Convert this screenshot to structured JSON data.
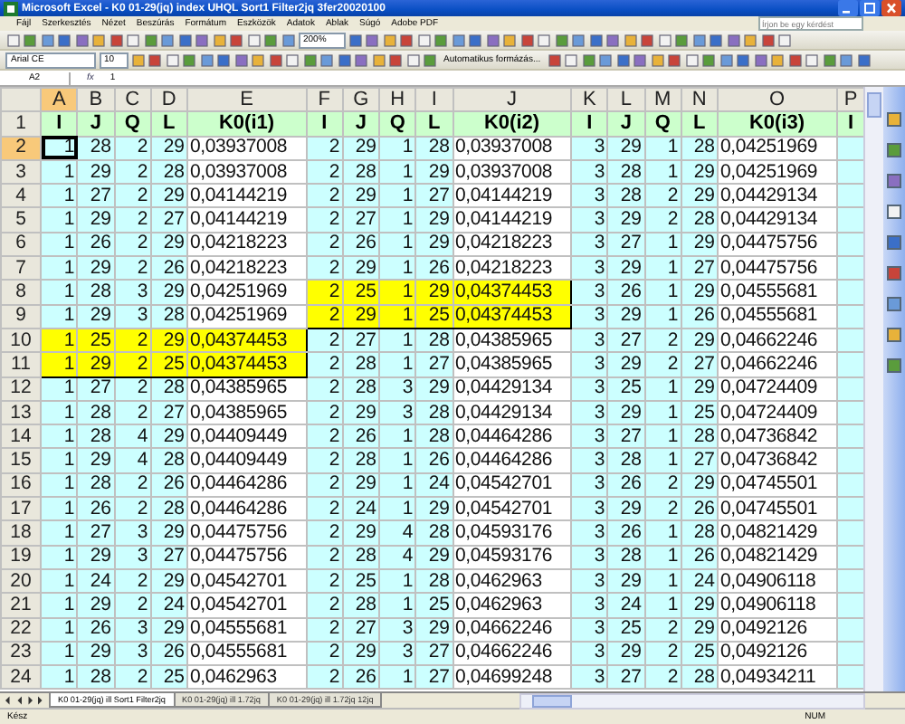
{
  "window": {
    "title": "Microsoft Excel - K0 01-29(jq) index UHQL Sort1 Filter2jq 3fer20020100"
  },
  "menu": [
    "Fájl",
    "Szerkesztés",
    "Nézet",
    "Beszúrás",
    "Formátum",
    "Eszközök",
    "Adatok",
    "Ablak",
    "Súgó",
    "Adobe PDF"
  ],
  "help_box": {
    "placeholder": "Írjon be egy kérdést"
  },
  "zoom": "200%",
  "formatting": {
    "font": "Arial CE",
    "size": "10",
    "autoformat": "Automatikus formázás..."
  },
  "formula_bar": {
    "cell": "A2",
    "function_label": "fx",
    "value": "1"
  },
  "columns": [
    {
      "letter": "A",
      "selected": true
    },
    {
      "letter": "B",
      "selected": false
    },
    {
      "letter": "C",
      "selected": false
    },
    {
      "letter": "D",
      "selected": false
    },
    {
      "letter": "E",
      "selected": false
    },
    {
      "letter": "F",
      "selected": false
    },
    {
      "letter": "G",
      "selected": false
    },
    {
      "letter": "H",
      "selected": false
    },
    {
      "letter": "I",
      "selected": false
    },
    {
      "letter": "J",
      "selected": false
    },
    {
      "letter": "K",
      "selected": false
    },
    {
      "letter": "L",
      "selected": false
    },
    {
      "letter": "M",
      "selected": false
    },
    {
      "letter": "N",
      "selected": false
    },
    {
      "letter": "O",
      "selected": false
    },
    {
      "letter": "P",
      "selected": false
    }
  ],
  "header_row": {
    "number": "1",
    "labels": [
      "I",
      "J",
      "Q",
      "L",
      "K0(i1)",
      "I",
      "J",
      "Q",
      "L",
      "K0(i2)",
      "I",
      "J",
      "Q",
      "L",
      "K0(i3)",
      "I"
    ]
  },
  "rows": [
    {
      "number": "2",
      "selected": true,
      "groups": [
        {
          "values": [
            "1",
            "28",
            "2",
            "29",
            "0,03937008"
          ],
          "highlighted": false
        },
        {
          "values": [
            "2",
            "29",
            "1",
            "28",
            "0,03937008"
          ],
          "highlighted": false
        },
        {
          "values": [
            "3",
            "29",
            "1",
            "28",
            "0,04251969"
          ],
          "highlighted": false
        }
      ]
    },
    {
      "number": "3",
      "selected": false,
      "groups": [
        {
          "values": [
            "1",
            "29",
            "2",
            "28",
            "0,03937008"
          ],
          "highlighted": false
        },
        {
          "values": [
            "2",
            "28",
            "1",
            "29",
            "0,03937008"
          ],
          "highlighted": false
        },
        {
          "values": [
            "3",
            "28",
            "1",
            "29",
            "0,04251969"
          ],
          "highlighted": false
        }
      ]
    },
    {
      "number": "4",
      "selected": false,
      "groups": [
        {
          "values": [
            "1",
            "27",
            "2",
            "29",
            "0,04144219"
          ],
          "highlighted": false
        },
        {
          "values": [
            "2",
            "29",
            "1",
            "27",
            "0,04144219"
          ],
          "highlighted": false
        },
        {
          "values": [
            "3",
            "28",
            "2",
            "29",
            "0,04429134"
          ],
          "highlighted": false
        }
      ]
    },
    {
      "number": "5",
      "selected": false,
      "groups": [
        {
          "values": [
            "1",
            "29",
            "2",
            "27",
            "0,04144219"
          ],
          "highlighted": false
        },
        {
          "values": [
            "2",
            "27",
            "1",
            "29",
            "0,04144219"
          ],
          "highlighted": false
        },
        {
          "values": [
            "3",
            "29",
            "2",
            "28",
            "0,04429134"
          ],
          "highlighted": false
        }
      ]
    },
    {
      "number": "6",
      "selected": false,
      "groups": [
        {
          "values": [
            "1",
            "26",
            "2",
            "29",
            "0,04218223"
          ],
          "highlighted": false
        },
        {
          "values": [
            "2",
            "26",
            "1",
            "29",
            "0,04218223"
          ],
          "highlighted": false
        },
        {
          "values": [
            "3",
            "27",
            "1",
            "29",
            "0,04475756"
          ],
          "highlighted": false
        }
      ]
    },
    {
      "number": "7",
      "selected": false,
      "groups": [
        {
          "values": [
            "1",
            "29",
            "2",
            "26",
            "0,04218223"
          ],
          "highlighted": false
        },
        {
          "values": [
            "2",
            "29",
            "1",
            "26",
            "0,04218223"
          ],
          "highlighted": false
        },
        {
          "values": [
            "3",
            "29",
            "1",
            "27",
            "0,04475756"
          ],
          "highlighted": false
        }
      ]
    },
    {
      "number": "8",
      "selected": false,
      "groups": [
        {
          "values": [
            "1",
            "28",
            "3",
            "29",
            "0,04251969"
          ],
          "highlighted": false
        },
        {
          "values": [
            "2",
            "25",
            "1",
            "29",
            "0,04374453"
          ],
          "highlighted": true
        },
        {
          "values": [
            "3",
            "26",
            "1",
            "29",
            "0,04555681"
          ],
          "highlighted": false
        }
      ]
    },
    {
      "number": "9",
      "selected": false,
      "groups": [
        {
          "values": [
            "1",
            "29",
            "3",
            "28",
            "0,04251969"
          ],
          "highlighted": false
        },
        {
          "values": [
            "2",
            "29",
            "1",
            "25",
            "0,04374453"
          ],
          "highlighted": true
        },
        {
          "values": [
            "3",
            "29",
            "1",
            "26",
            "0,04555681"
          ],
          "highlighted": false
        }
      ]
    },
    {
      "number": "10",
      "selected": false,
      "groups": [
        {
          "values": [
            "1",
            "25",
            "2",
            "29",
            "0,04374453"
          ],
          "highlighted": true
        },
        {
          "values": [
            "2",
            "27",
            "1",
            "28",
            "0,04385965"
          ],
          "highlighted": false
        },
        {
          "values": [
            "3",
            "27",
            "2",
            "29",
            "0,04662246"
          ],
          "highlighted": false
        }
      ]
    },
    {
      "number": "11",
      "selected": false,
      "groups": [
        {
          "values": [
            "1",
            "29",
            "2",
            "25",
            "0,04374453"
          ],
          "highlighted": true
        },
        {
          "values": [
            "2",
            "28",
            "1",
            "27",
            "0,04385965"
          ],
          "highlighted": false
        },
        {
          "values": [
            "3",
            "29",
            "2",
            "27",
            "0,04662246"
          ],
          "highlighted": false
        }
      ]
    },
    {
      "number": "12",
      "selected": false,
      "groups": [
        {
          "values": [
            "1",
            "27",
            "2",
            "28",
            "0,04385965"
          ],
          "highlighted": false
        },
        {
          "values": [
            "2",
            "28",
            "3",
            "29",
            "0,04429134"
          ],
          "highlighted": false
        },
        {
          "values": [
            "3",
            "25",
            "1",
            "29",
            "0,04724409"
          ],
          "highlighted": false
        }
      ]
    },
    {
      "number": "13",
      "selected": false,
      "groups": [
        {
          "values": [
            "1",
            "28",
            "2",
            "27",
            "0,04385965"
          ],
          "highlighted": false
        },
        {
          "values": [
            "2",
            "29",
            "3",
            "28",
            "0,04429134"
          ],
          "highlighted": false
        },
        {
          "values": [
            "3",
            "29",
            "1",
            "25",
            "0,04724409"
          ],
          "highlighted": false
        }
      ]
    },
    {
      "number": "14",
      "selected": false,
      "groups": [
        {
          "values": [
            "1",
            "28",
            "4",
            "29",
            "0,04409449"
          ],
          "highlighted": false
        },
        {
          "values": [
            "2",
            "26",
            "1",
            "28",
            "0,04464286"
          ],
          "highlighted": false
        },
        {
          "values": [
            "3",
            "27",
            "1",
            "28",
            "0,04736842"
          ],
          "highlighted": false
        }
      ]
    },
    {
      "number": "15",
      "selected": false,
      "groups": [
        {
          "values": [
            "1",
            "29",
            "4",
            "28",
            "0,04409449"
          ],
          "highlighted": false
        },
        {
          "values": [
            "2",
            "28",
            "1",
            "26",
            "0,04464286"
          ],
          "highlighted": false
        },
        {
          "values": [
            "3",
            "28",
            "1",
            "27",
            "0,04736842"
          ],
          "highlighted": false
        }
      ]
    },
    {
      "number": "16",
      "selected": false,
      "groups": [
        {
          "values": [
            "1",
            "28",
            "2",
            "26",
            "0,04464286"
          ],
          "highlighted": false
        },
        {
          "values": [
            "2",
            "29",
            "1",
            "24",
            "0,04542701"
          ],
          "highlighted": false
        },
        {
          "values": [
            "3",
            "26",
            "2",
            "29",
            "0,04745501"
          ],
          "highlighted": false
        }
      ]
    },
    {
      "number": "17",
      "selected": false,
      "groups": [
        {
          "values": [
            "1",
            "26",
            "2",
            "28",
            "0,04464286"
          ],
          "highlighted": false
        },
        {
          "values": [
            "2",
            "24",
            "1",
            "29",
            "0,04542701"
          ],
          "highlighted": false
        },
        {
          "values": [
            "3",
            "29",
            "2",
            "26",
            "0,04745501"
          ],
          "highlighted": false
        }
      ]
    },
    {
      "number": "18",
      "selected": false,
      "groups": [
        {
          "values": [
            "1",
            "27",
            "3",
            "29",
            "0,04475756"
          ],
          "highlighted": false
        },
        {
          "values": [
            "2",
            "29",
            "4",
            "28",
            "0,04593176"
          ],
          "highlighted": false
        },
        {
          "values": [
            "3",
            "26",
            "1",
            "28",
            "0,04821429"
          ],
          "highlighted": false
        }
      ]
    },
    {
      "number": "19",
      "selected": false,
      "groups": [
        {
          "values": [
            "1",
            "29",
            "3",
            "27",
            "0,04475756"
          ],
          "highlighted": false
        },
        {
          "values": [
            "2",
            "28",
            "4",
            "29",
            "0,04593176"
          ],
          "highlighted": false
        },
        {
          "values": [
            "3",
            "28",
            "1",
            "26",
            "0,04821429"
          ],
          "highlighted": false
        }
      ]
    },
    {
      "number": "20",
      "selected": false,
      "groups": [
        {
          "values": [
            "1",
            "24",
            "2",
            "29",
            "0,04542701"
          ],
          "highlighted": false
        },
        {
          "values": [
            "2",
            "25",
            "1",
            "28",
            "0,0462963"
          ],
          "highlighted": false
        },
        {
          "values": [
            "3",
            "29",
            "1",
            "24",
            "0,04906118"
          ],
          "highlighted": false
        }
      ]
    },
    {
      "number": "21",
      "selected": false,
      "groups": [
        {
          "values": [
            "1",
            "29",
            "2",
            "24",
            "0,04542701"
          ],
          "highlighted": false
        },
        {
          "values": [
            "2",
            "28",
            "1",
            "25",
            "0,0462963"
          ],
          "highlighted": false
        },
        {
          "values": [
            "3",
            "24",
            "1",
            "29",
            "0,04906118"
          ],
          "highlighted": false
        }
      ]
    },
    {
      "number": "22",
      "selected": false,
      "groups": [
        {
          "values": [
            "1",
            "26",
            "3",
            "29",
            "0,04555681"
          ],
          "highlighted": false
        },
        {
          "values": [
            "2",
            "27",
            "3",
            "29",
            "0,04662246"
          ],
          "highlighted": false
        },
        {
          "values": [
            "3",
            "25",
            "2",
            "29",
            "0,0492126"
          ],
          "highlighted": false
        }
      ]
    },
    {
      "number": "23",
      "selected": false,
      "groups": [
        {
          "values": [
            "1",
            "29",
            "3",
            "26",
            "0,04555681"
          ],
          "highlighted": false
        },
        {
          "values": [
            "2",
            "29",
            "3",
            "27",
            "0,04662246"
          ],
          "highlighted": false
        },
        {
          "values": [
            "3",
            "29",
            "2",
            "25",
            "0,0492126"
          ],
          "highlighted": false
        }
      ]
    },
    {
      "number": "24",
      "selected": false,
      "groups": [
        {
          "values": [
            "1",
            "28",
            "2",
            "25",
            "0,0462963"
          ],
          "highlighted": false
        },
        {
          "values": [
            "2",
            "26",
            "1",
            "27",
            "0,04699248"
          ],
          "highlighted": false
        },
        {
          "values": [
            "3",
            "27",
            "2",
            "28",
            "0,04934211"
          ],
          "highlighted": false
        }
      ]
    }
  ],
  "sheet_tabs": [
    {
      "label": "K0 01-29(jq) ill Sort1 Filter2jq",
      "selected": true
    },
    {
      "label": "K0 01-29(jq) ill 1.72jq",
      "selected": false
    },
    {
      "label": "K0 01-29(jq) ill 1.72jq 12jq",
      "selected": false
    }
  ],
  "status_bar": {
    "left": "Kész",
    "right": "NUM"
  }
}
